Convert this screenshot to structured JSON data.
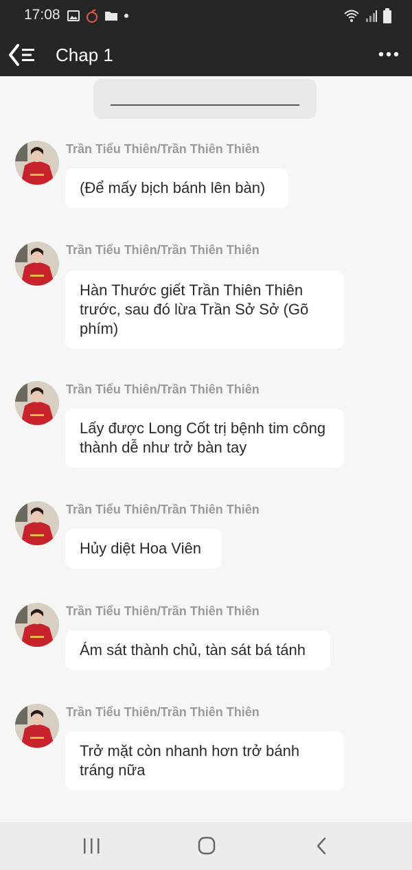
{
  "status_bar": {
    "time": "17:08",
    "left_icons": [
      "image-icon",
      "apple-icon",
      "folder-icon",
      "dot-icon"
    ],
    "right_icons": [
      "wifi-icon",
      "signal-icon",
      "battery-icon"
    ]
  },
  "header": {
    "title": "Chap 1",
    "back_icon": "back-list-icon",
    "more_icon": "more-dots-icon"
  },
  "messages": [
    {
      "sender": "Trần Tiểu Thiên/Trần Thiên Thiên",
      "text": "(Để mấy bịch bánh lên bàn)"
    },
    {
      "sender": "Trần Tiểu Thiên/Trần Thiên Thiên",
      "text": "Hàn Thước giết Trần Thiên Thiên trước, sau đó lừa Trần Sở Sở (Gõ phím)"
    },
    {
      "sender": "Trần Tiểu Thiên/Trần Thiên Thiên",
      "text": "Lấy được Long Cốt trị bệnh tim công thành dễ như trở bàn tay"
    },
    {
      "sender": "Trần Tiểu Thiên/Trần Thiên Thiên",
      "text": "Hủy diệt Hoa Viên"
    },
    {
      "sender": "Trần Tiểu Thiên/Trần Thiên Thiên",
      "text": "Ám sát thành chủ, tàn sát bá tánh"
    },
    {
      "sender": "Trần Tiểu Thiên/Trần Thiên Thiên",
      "text": "Trở mặt còn nhanh hơn trở bánh tráng nữa"
    }
  ],
  "nav_bar": {
    "icons": [
      "recent-apps-icon",
      "home-icon",
      "back-icon"
    ]
  },
  "colors": {
    "header_bg": "#262626",
    "page_bg": "#f6f6f6",
    "bubble_bg": "#ffffff",
    "sender_text": "#9a9a9a"
  }
}
